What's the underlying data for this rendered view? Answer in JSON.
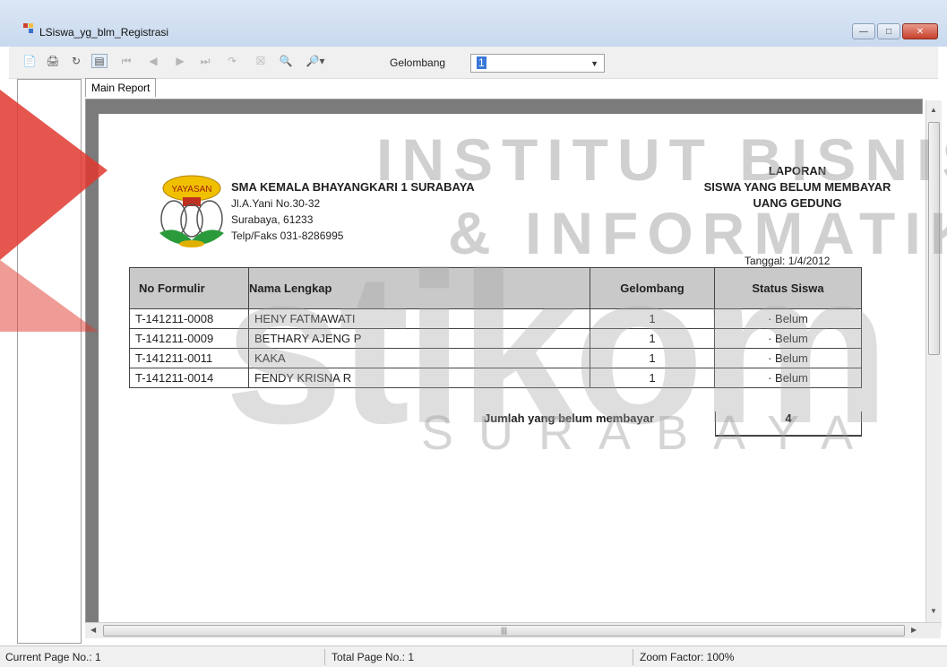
{
  "window": {
    "title": "LSiswa_yg_blm_Registrasi"
  },
  "toolbar": {
    "gelombang_label": "Gelombang",
    "gelombang_value": "1"
  },
  "tabs": [
    {
      "label": "Main Report"
    }
  ],
  "report": {
    "school_name": "SMA KEMALA BHAYANGKARI 1 SURABAYA",
    "address_line1": "Jl.A.Yani No.30-32",
    "address_line2": "Surabaya, 61233",
    "address_line3": "Telp/Faks 031-8286995",
    "logo_text": "YAYASAN",
    "title_line1": "LAPORAN",
    "title_line2": "SISWA YANG BELUM MEMBAYAR",
    "title_line3": "UANG GEDUNG",
    "tanggal_label": "Tanggal:",
    "tanggal_value": "1/4/2012",
    "columns": [
      "No Formulir",
      "Nama Lengkap",
      "Gelombang",
      "Status Siswa"
    ],
    "rows": [
      {
        "no": "T-141211-0008",
        "nama": "HENY FATMAWATI",
        "gel": "1",
        "status": "· Belum"
      },
      {
        "no": "T-141211-0009",
        "nama": "BETHARY AJENG P",
        "gel": "1",
        "status": "· Belum"
      },
      {
        "no": "T-141211-0011",
        "nama": "KAKA",
        "gel": "1",
        "status": "· Belum"
      },
      {
        "no": "T-141211-0014",
        "nama": "FENDY KRISNA R",
        "gel": "1",
        "status": "· Belum"
      }
    ],
    "total_label": "Jumlah yang belum membayar",
    "total_value": "4"
  },
  "watermark": {
    "line1": "INSTITUT BISNIS",
    "line2": "& INFORMATIKA",
    "line3": "stikom",
    "line4": "SURABAYA"
  },
  "statusbar": {
    "current_page": "Current Page No.: 1",
    "total_page": "Total Page No.: 1",
    "zoom": "Zoom Factor: 100%"
  },
  "colors": {
    "titlebar": "#c9d9ee",
    "report_bg": "#7b7b7b",
    "header_fill": "#c9c9c9",
    "watermark_red": "#e03a2f",
    "selection_blue": "#3a78d8"
  }
}
